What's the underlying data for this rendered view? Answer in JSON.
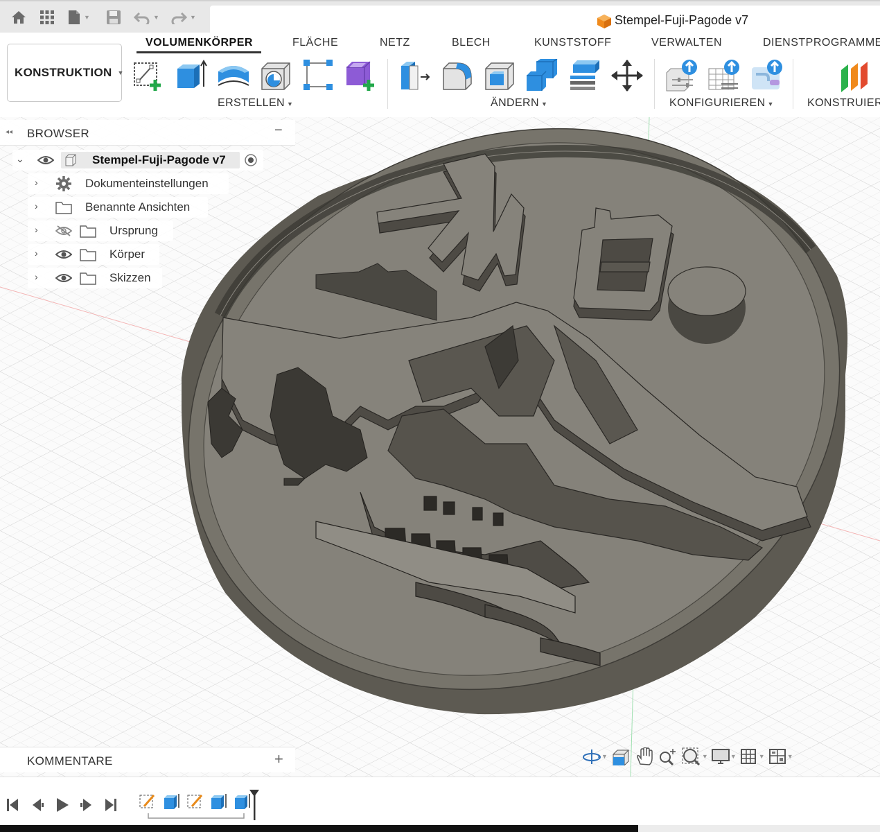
{
  "title_bar": {
    "document_title": "Stempel-Fuji-Pagode v7",
    "quick_access": [
      "home-icon",
      "grid-icon",
      "file-icon",
      "save-icon",
      "undo-icon",
      "redo-icon"
    ]
  },
  "toolbar": {
    "workspace_button": "KONSTRUKTION",
    "tabs": [
      "VOLUMENKÖRPER",
      "FLÄCHE",
      "NETZ",
      "BLECH",
      "KUNSTSTOFF",
      "VERWALTEN",
      "DIENSTPROGRAMME"
    ],
    "active_tab": "VOLUMENKÖRPER",
    "groups": [
      "ERSTELLEN",
      "ÄNDERN",
      "KONFIGURIEREN",
      "KONSTRUIER"
    ],
    "tools_create": [
      "create-sketch-icon",
      "extrude-icon",
      "revolve-icon",
      "hole-icon",
      "pattern-icon",
      "new-component-icon"
    ],
    "tools_modify": [
      "press-pull-icon",
      "fillet-icon",
      "shell-icon",
      "combine-icon",
      "align-icon",
      "move-icon"
    ],
    "tools_configure": [
      "configure-parameters-icon",
      "configure-table-icon",
      "configure-rules-icon"
    ],
    "tools_construct": [
      "offset-plane-icon"
    ]
  },
  "browser": {
    "title": "BROWSER",
    "root": "Stempel-Fuji-Pagode v7",
    "items": [
      {
        "label": "Dokumenteinstellungen",
        "icon": "gear-icon"
      },
      {
        "label": "Benannte Ansichten",
        "icon": "folder-icon"
      },
      {
        "label": "Ursprung",
        "icon": "folder-icon",
        "visibility": "hidden"
      },
      {
        "label": "Körper",
        "icon": "folder-icon",
        "visibility": "visible"
      },
      {
        "label": "Skizzen",
        "icon": "folder-icon",
        "visibility": "visible"
      }
    ]
  },
  "comments": {
    "title": "KOMMENTARE"
  },
  "navigation": [
    "orbit-icon",
    "look-at-icon",
    "pan-icon",
    "zoom-icon",
    "fit-icon",
    "display-settings-icon",
    "grid-settings-icon",
    "viewports-icon"
  ],
  "timeline": {
    "controls": [
      "go-to-start-icon",
      "step-back-icon",
      "play-icon",
      "step-forward-icon",
      "go-to-end-icon"
    ],
    "features": [
      "sketch-feature-icon",
      "extrude-feature-icon",
      "sketch-feature-icon",
      "extrude-feature-icon",
      "extrude-feature-icon"
    ]
  },
  "colors": {
    "stamp_body": "#77746b",
    "stamp_face": "#85827a",
    "accent_blue": "#2e8fe0",
    "add_green": "#22a84a"
  }
}
